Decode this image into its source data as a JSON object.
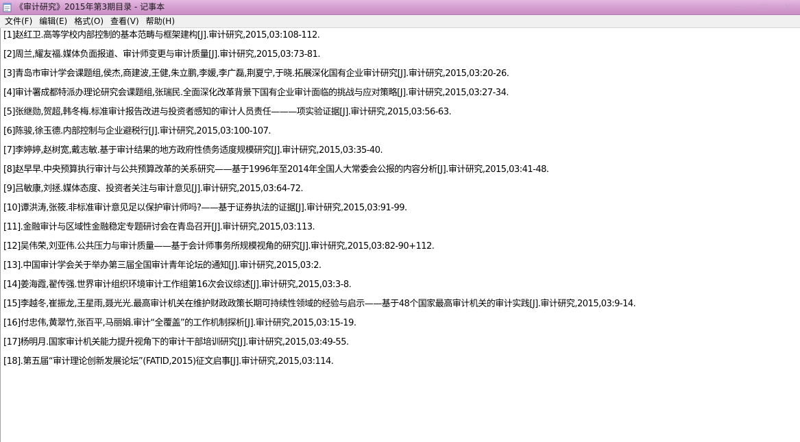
{
  "window": {
    "title": "《审计研究》2015年第3期目录 - 记事本",
    "controls": {
      "minimize": "─",
      "maximize": "□",
      "close": "✕"
    }
  },
  "menu": {
    "items": [
      {
        "label": "文件(F)"
      },
      {
        "label": "编辑(E)"
      },
      {
        "label": "格式(O)"
      },
      {
        "label": "查看(V)"
      },
      {
        "label": "帮助(H)"
      }
    ]
  },
  "document": {
    "lines": [
      "[1]赵红卫.高等学校内部控制的基本范畴与框架建构[J].审计研究,2015,03:108-112.",
      "[2]周兰,耀友福.媒体负面报道、审计师变更与审计质量[J].审计研究,2015,03:73-81.",
      "[3]青岛市审计学会课题组,侯杰,商建波,王健,朱立鹏,李媛,李广磊,荆夏宁,于晓.拓展深化国有企业审计研究[J].审计研究,2015,03:20-26.",
      "[4]审计署成都特派办理论研究会课题组,张瑞民.全面深化改革背景下国有企业审计面临的挑战与应对策略[J].审计研究,2015,03:27-34.",
      "[5]张继勋,贺超,韩冬梅.标准审计报告改进与投资者感知的审计人员责任———项实验证据[J].审计研究,2015,03:56-63.",
      "[6]陈骏,徐玉德.内部控制与企业避税行[J].审计研究,2015,03:100-107.",
      "[7]李婷婷,赵树宽,戴志敏.基于审计结果的地方政府性债务适度规模研究[J].审计研究,2015,03:35-40.",
      "[8]赵早早.中央预算执行审计与公共预算改革的关系研究——基于1996年至2014年全国人大常委会公报的内容分析[J].审计研究,2015,03:41-48.",
      "[9]吕敏康,刘拯.媒体态度、投资者关注与审计意见[J].审计研究,2015,03:64-72.",
      "[10]谭洪涛,张筱.非标准审计意见足以保护审计师吗?——基于证券执法的证据[J].审计研究,2015,03:91-99.",
      "[11].金融审计与区域性金融稳定专题研讨会在青岛召开[J].审计研究,2015,03:113.",
      "[12]吴伟荣,刘亚伟.公共压力与审计质量——基于会计师事务所规模视角的研究[J].审计研究,2015,03:82-90+112.",
      "[13].中国审计学会关于举办第三届全国审计青年论坛的通知[J].审计研究,2015,03:2.",
      "[14]姜海霞,翟传强.世界审计组织环境审计工作组第16次会议综述[J].审计研究,2015,03:3-8.",
      "[15]李越冬,崔振龙,王星雨,聂光光.最高审计机关在维护财政政策长期可持续性领域的经验与启示——基于48个国家最高审计机关的审计实践[J].审计研究,2015,03:9-14.",
      "[16]付忠伟,黄翠竹,张百平,马丽娟.审计“全覆盖”的工作机制探析[J].审计研究,2015,03:15-19.",
      "[17]杨明月.国家审计机关能力提升视角下的审计干部培训研究[J].审计研究,2015,03:49-55.",
      "[18].第五届“审计理论创新发展论坛”(FATID,2015)征文启事[J].审计研究,2015,03:114."
    ]
  }
}
